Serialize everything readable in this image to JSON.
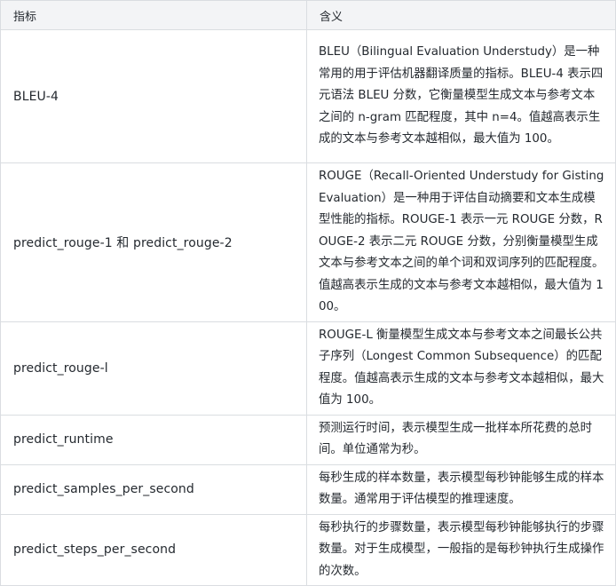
{
  "table": {
    "headers": [
      "指标",
      "含义"
    ],
    "rows": [
      {
        "metric": "BLEU-4",
        "meaning": "BLEU（Bilingual Evaluation Understudy）是一种常用的用于评估机器翻译质量的指标。BLEU-4 表示四元语法 BLEU 分数，它衡量模型生成文本与参考文本之间的 n-gram 匹配程度，其中 n=4。值越高表示生成的文本与参考文本越相似，最大值为 100。"
      },
      {
        "metric": "predict_rouge-1 和 predict_rouge-2",
        "meaning": "ROUGE（Recall-Oriented Understudy for Gisting Evaluation）是一种用于评估自动摘要和文本生成模型性能的指标。ROUGE-1 表示一元 ROUGE 分数，ROUGE-2 表示二元 ROUGE 分数，分别衡量模型生成文本与参考文本之间的单个词和双词序列的匹配程度。值越高表示生成的文本与参考文本越相似，最大值为 100。"
      },
      {
        "metric": "predict_rouge-l",
        "meaning": "ROUGE-L 衡量模型生成文本与参考文本之间最长公共子序列（Longest Common Subsequence）的匹配程度。值越高表示生成的文本与参考文本越相似，最大值为 100。"
      },
      {
        "metric": "predict_runtime",
        "meaning": "预测运行时间，表示模型生成一批样本所花费的总时间。单位通常为秒。"
      },
      {
        "metric": "predict_samples_per_second",
        "meaning": "每秒生成的样本数量，表示模型每秒钟能够生成的样本数量。通常用于评估模型的推理速度。"
      },
      {
        "metric": "predict_steps_per_second",
        "meaning": "每秒执行的步骤数量，表示模型每秒钟能够执行的步骤数量。对于生成模型，一般指的是每秒钟执行生成操作的次数。"
      }
    ]
  }
}
